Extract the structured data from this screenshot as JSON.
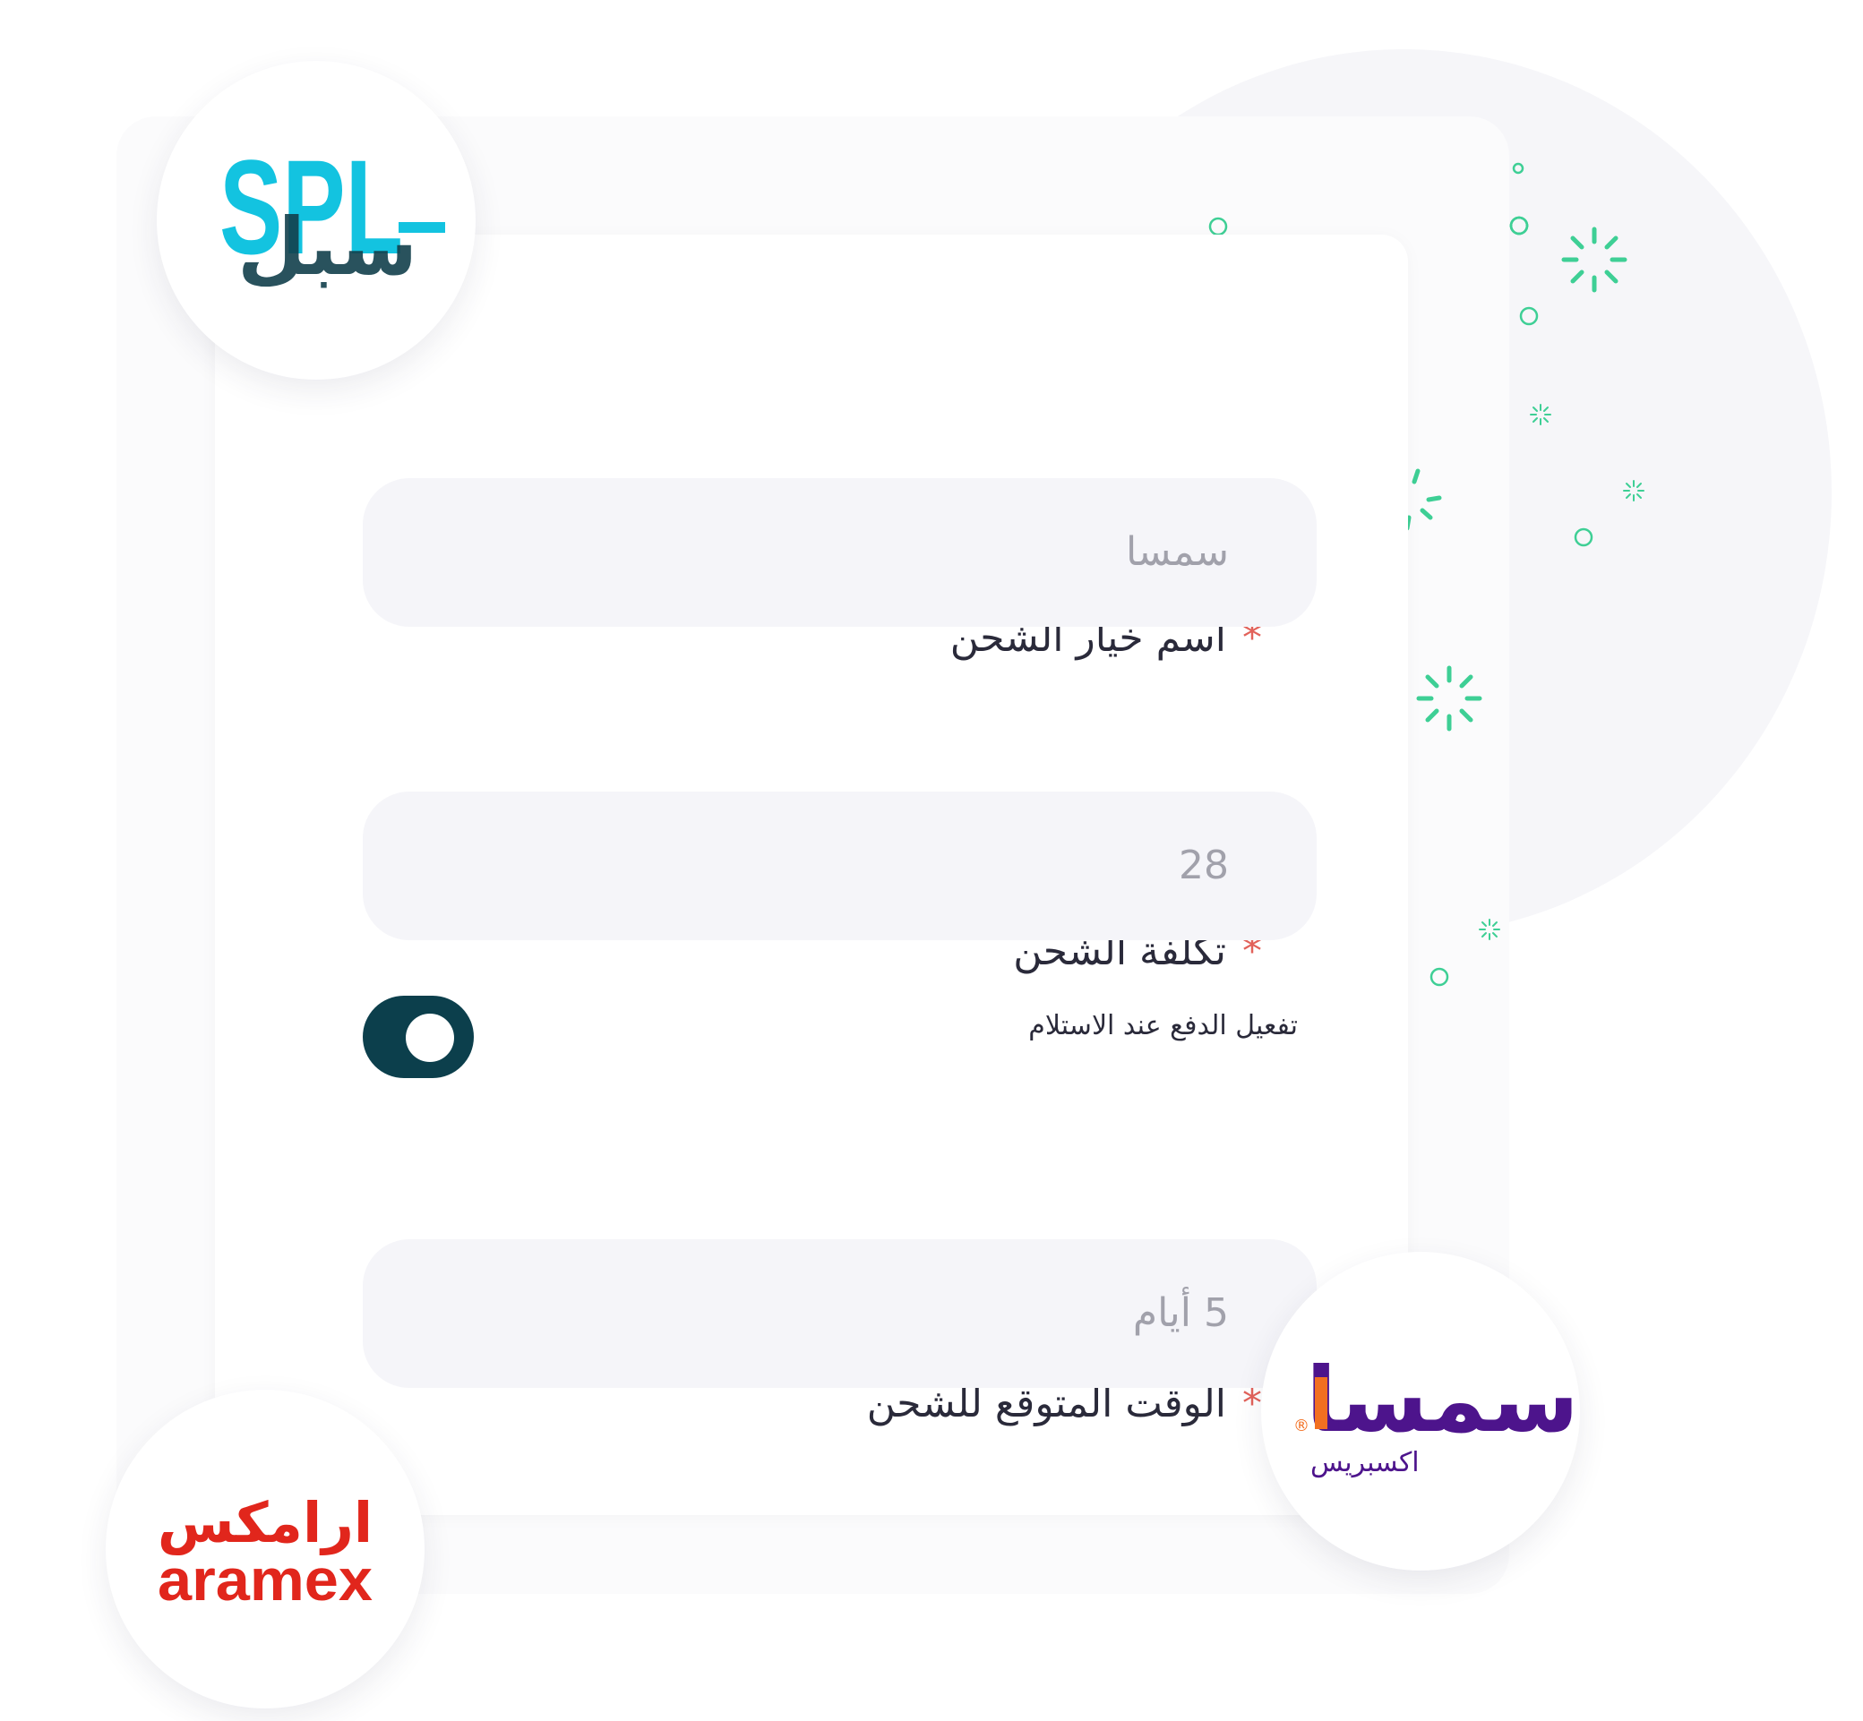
{
  "form": {
    "shipping_name": {
      "label": "اسم خيار الشحن",
      "required_mark": "*",
      "value": "سمسا"
    },
    "shipping_cost": {
      "label": "تكلفة الشحن",
      "required_mark": "*",
      "value": "28"
    },
    "cod_toggle": {
      "label": "تفعيل الدفع عند الاستلام",
      "state": "on"
    },
    "delivery_time": {
      "label": "الوقت المتوقع للشحن",
      "required_mark": "*",
      "value": "5 أيام"
    }
  },
  "logos": {
    "spl": {
      "latin": "SPL",
      "arabic": "سبل"
    },
    "smsa": {
      "arabic": "سمسا",
      "sub": "اكسبريس",
      "registered": "®"
    },
    "aramex": {
      "arabic": "ارامكس",
      "latin": "aramex"
    }
  },
  "colors": {
    "accent": "#0c3f4c",
    "required": "#e2625a",
    "input_bg": "#f5f5f9",
    "spark": "#3ecf95",
    "spl_cyan": "#13c3e0",
    "spl_dark": "#12404c",
    "smsa_orange": "#f26f21",
    "smsa_purple": "#4d148c",
    "aramex_red": "#e1261c"
  }
}
